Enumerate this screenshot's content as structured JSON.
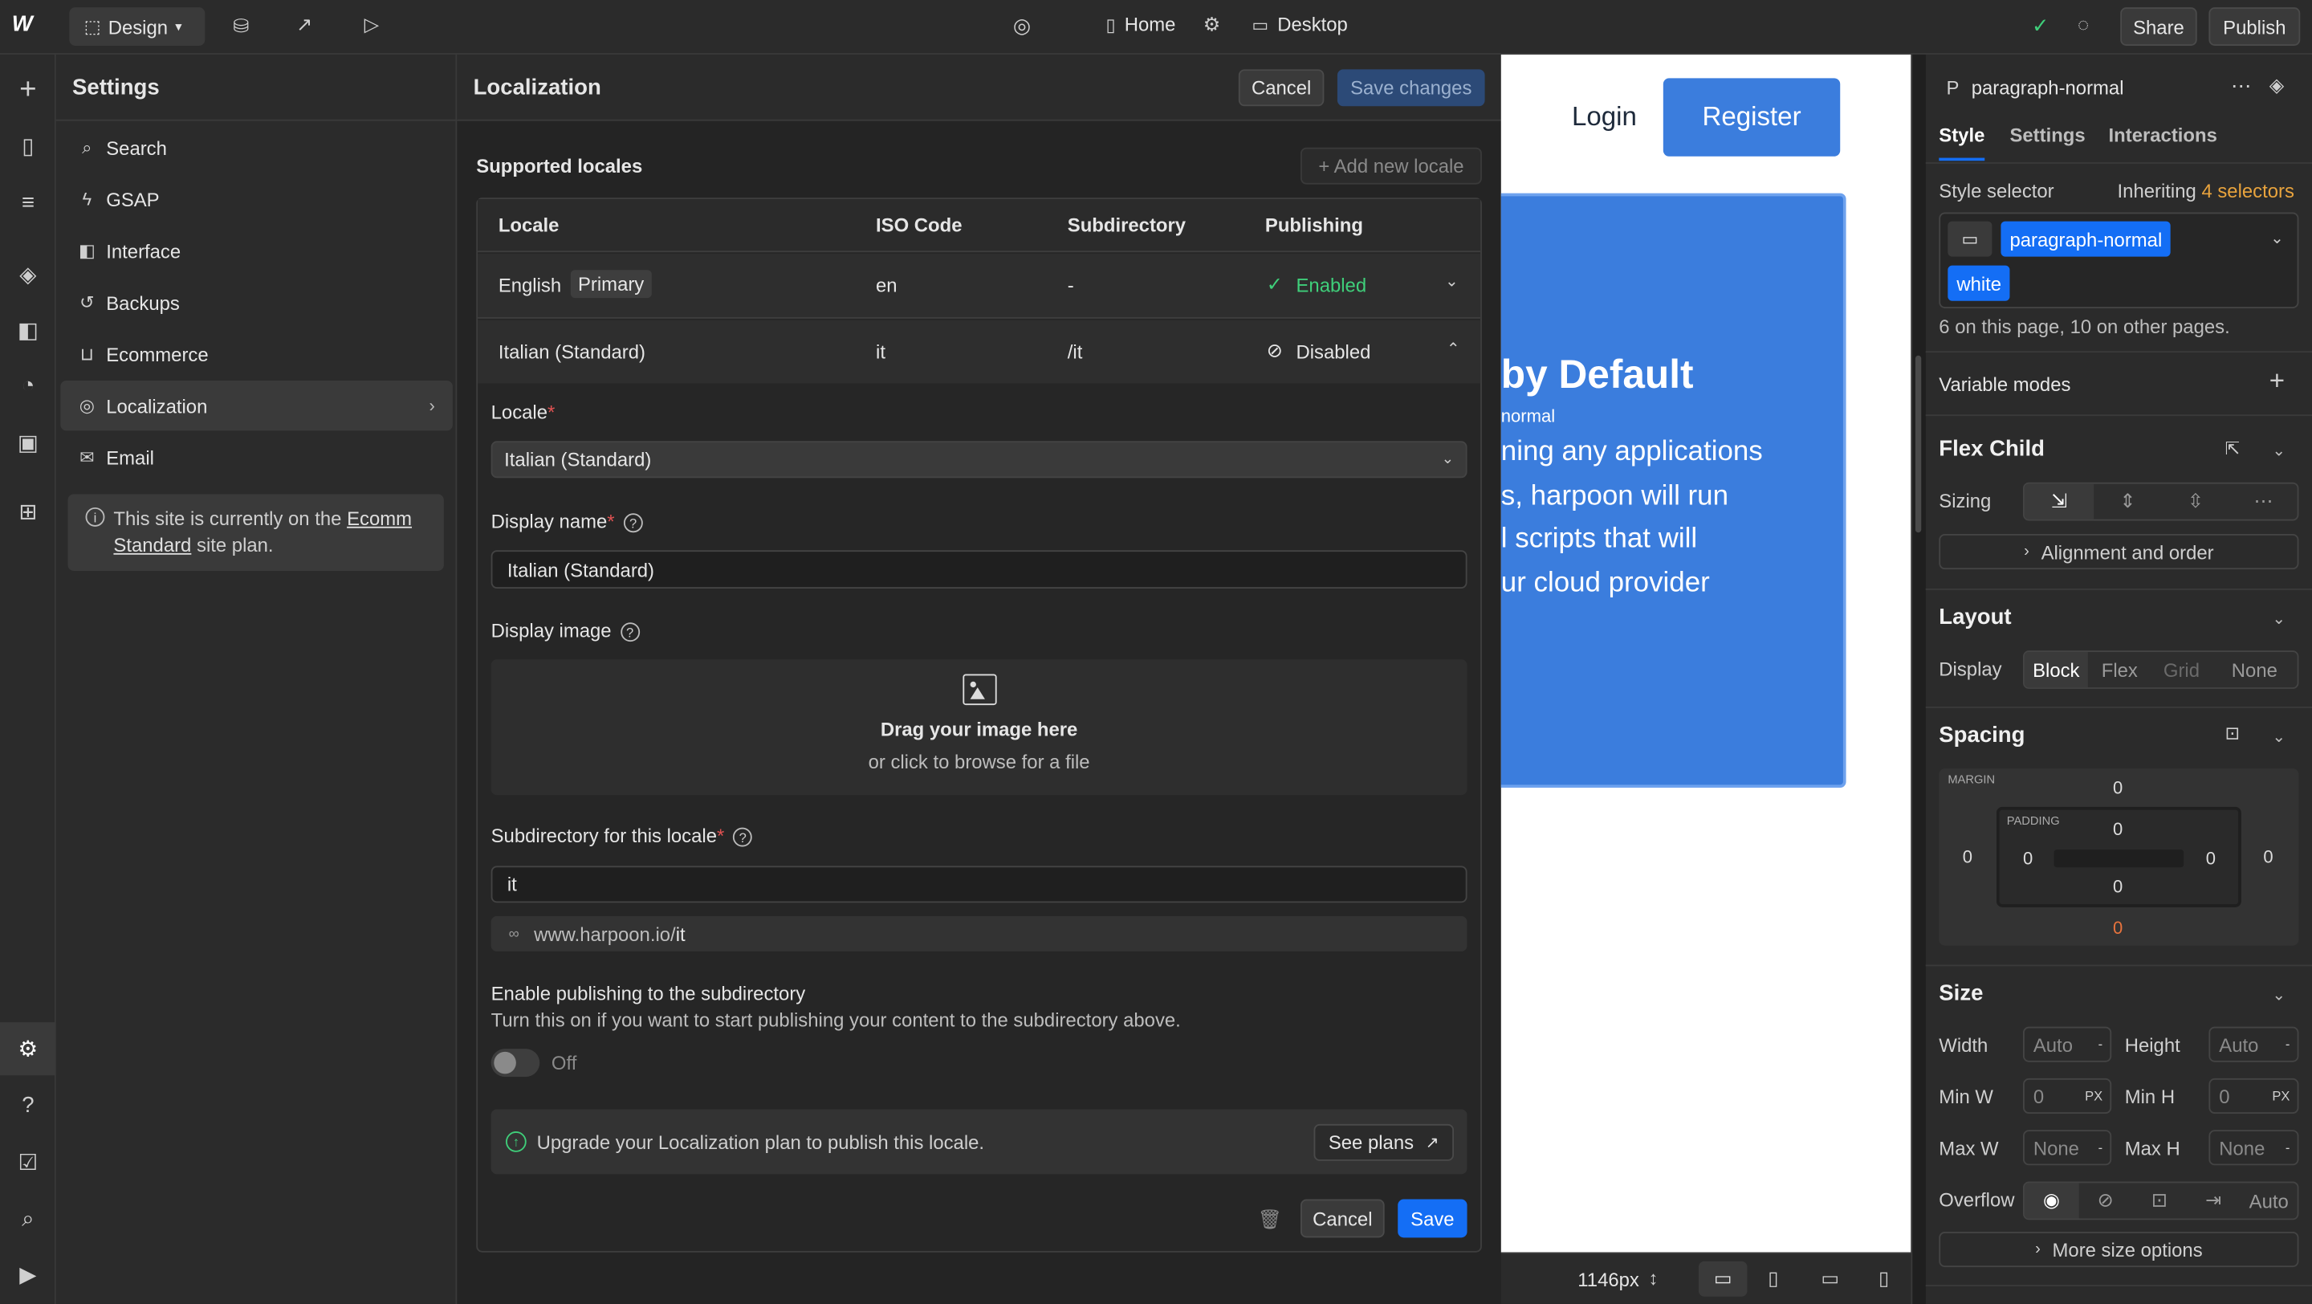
{
  "topbar": {
    "mode_label": "Design",
    "page_label": "Home",
    "breakpoint_label": "Desktop",
    "share_label": "Share",
    "publish_label": "Publish"
  },
  "settings": {
    "title": "Settings",
    "items": [
      {
        "label": "Search",
        "icon": "search-icon"
      },
      {
        "label": "GSAP",
        "icon": "bolt-icon"
      },
      {
        "label": "Interface",
        "icon": "layout-icon"
      },
      {
        "label": "Backups",
        "icon": "history-icon"
      },
      {
        "label": "Ecommerce",
        "icon": "basket-icon"
      },
      {
        "label": "Localization",
        "icon": "globe-icon"
      },
      {
        "label": "Email",
        "icon": "mail-icon"
      }
    ],
    "notice_prefix": "This site is currently on the",
    "notice_link": "Ecomm Standard",
    "notice_suffix": "site plan."
  },
  "localization": {
    "title": "Localization",
    "cancel_label": "Cancel",
    "save_changes_label": "Save changes",
    "supported_locales_label": "Supported locales",
    "add_locale_label": "+ Add new locale",
    "table": {
      "headers": [
        "Locale",
        "ISO Code",
        "Subdirectory",
        "Publishing"
      ],
      "rows": [
        {
          "locale": "English",
          "badge": "Primary",
          "iso": "en",
          "subdir": "-",
          "status": "Enabled"
        },
        {
          "locale": "Italian (Standard)",
          "badge": "",
          "iso": "it",
          "subdir": "/it",
          "status": "Disabled"
        }
      ]
    },
    "form": {
      "locale_label": "Locale",
      "locale_value": "Italian (Standard)",
      "display_name_label": "Display name",
      "display_name_value": "Italian (Standard)",
      "display_image_label": "Display image",
      "drop_title": "Drag your image here",
      "drop_sub": "or click to browse for a file",
      "subdir_label": "Subdirectory for this locale",
      "subdir_value": "it",
      "url_prefix": "www.harpoon.io/",
      "url_suffix": "it",
      "publish_title": "Enable publishing to the subdirectory",
      "publish_desc": "Turn this on if you want to start publishing your content to the subdirectory above.",
      "toggle_label": "Off",
      "upgrade_text": "Upgrade your Localization plan to publish this locale.",
      "see_plans_label": "See plans",
      "cancel_label": "Cancel",
      "save_label": "Save"
    }
  },
  "canvas": {
    "login_label": "Login",
    "register_label": "Register",
    "heading_fragment": "by Default",
    "class_tag": "normal",
    "body_lines": [
      "ning any applications",
      "s, harpoon will run",
      "l scripts that will",
      "ur cloud provider"
    ],
    "width_label": "1146px"
  },
  "right_panel": {
    "element_tag": "P",
    "element_name": "paragraph-normal",
    "tabs": [
      "Style",
      "Settings",
      "Interactions"
    ],
    "style_selector_label": "Style selector",
    "inheriting_label": "Inheriting",
    "selector_count": "4 selectors",
    "class_chips": [
      "paragraph-normal",
      "white"
    ],
    "usage_text": "6 on this page, 10 on other pages.",
    "variable_modes_label": "Variable modes",
    "flex_child_label": "Flex Child",
    "sizing_label": "Sizing",
    "alignment_label": "Alignment and order",
    "layout_label": "Layout",
    "display_label": "Display",
    "display_options": [
      "Block",
      "Flex",
      "Grid",
      "None"
    ],
    "spacing_label": "Spacing",
    "margin_label": "MARGIN",
    "padding_label": "PADDING",
    "margin_values": {
      "top": "0",
      "left": "0",
      "right": "0",
      "bottom": "0"
    },
    "padding_values": {
      "top": "0",
      "left": "0",
      "right": "0",
      "bottom": "0"
    },
    "size_label": "Size",
    "width_label": "Width",
    "width_value": "Auto",
    "height_label": "Height",
    "height_value": "Auto",
    "minw_label": "Min W",
    "minw_value": "0",
    "minh_label": "Min H",
    "minh_value": "0",
    "maxw_label": "Max W",
    "maxw_value": "None",
    "maxh_label": "Max H",
    "maxh_value": "None",
    "unit_px": "PX",
    "overflow_label": "Overflow",
    "overflow_auto": "Auto",
    "more_size_label": "More size options"
  },
  "colors": {
    "accent": "#146ef5",
    "canvas_blue": "#3b7ddd",
    "success": "#3fcf7a",
    "selector_orange": "#e8a33d"
  }
}
